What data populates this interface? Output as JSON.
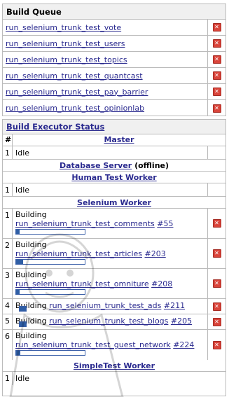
{
  "build_queue": {
    "title": "Build Queue",
    "items": [
      "run_selenium_trunk_test_vote",
      "run_selenium_trunk_test_users",
      "run_selenium_trunk_test_topics",
      "run_selenium_trunk_test_quantcast",
      "run_selenium_trunk_test_pay_barrier",
      "run_selenium_trunk_test_opinionlab"
    ],
    "cancel_icon": "cancel-icon"
  },
  "executors": {
    "title": "Build Executor Status",
    "col_num": "#",
    "master": {
      "label": "Master",
      "slots": [
        {
          "num": "1",
          "status": "Idle"
        }
      ]
    },
    "database_server": {
      "label": "Database Server",
      "suffix": "(offline)"
    },
    "human_test_worker": {
      "label": "Human Test Worker",
      "slots": [
        {
          "num": "1",
          "status": "Idle"
        }
      ]
    },
    "selenium_worker": {
      "label": "Selenium Worker",
      "slots": [
        {
          "num": "1",
          "status": "Building",
          "job": "run_selenium_trunk_test_comments",
          "build": "#55",
          "progress": 0.05
        },
        {
          "num": "2",
          "status": "Building",
          "job": "run_selenium_trunk_test_articles",
          "build": "#203",
          "progress": 0.1
        },
        {
          "num": "3",
          "status": "Building",
          "job": "run_selenium_trunk_test_omniture",
          "build": "#208",
          "progress": 0.05
        },
        {
          "num": "4",
          "status": "Building",
          "job": "run_selenium_trunk_test_ads",
          "build": "#211",
          "progress": 0.08
        },
        {
          "num": "5",
          "status": "Building",
          "job": "run_selenium_trunk_test_blogs",
          "build": "#205",
          "progress": 0.07
        },
        {
          "num": "6",
          "status": "Building",
          "job": "run_selenium_trunk_test_guest_network",
          "build": "#224",
          "progress": 0.06
        }
      ]
    },
    "simpletest_worker": {
      "label": "SimpleTest Worker",
      "slots": [
        {
          "num": "1",
          "status": "Idle"
        }
      ]
    }
  },
  "colors": {
    "link": "#2a2a8f",
    "progress": "#2f5ea5",
    "cancel": "#d9443a"
  }
}
